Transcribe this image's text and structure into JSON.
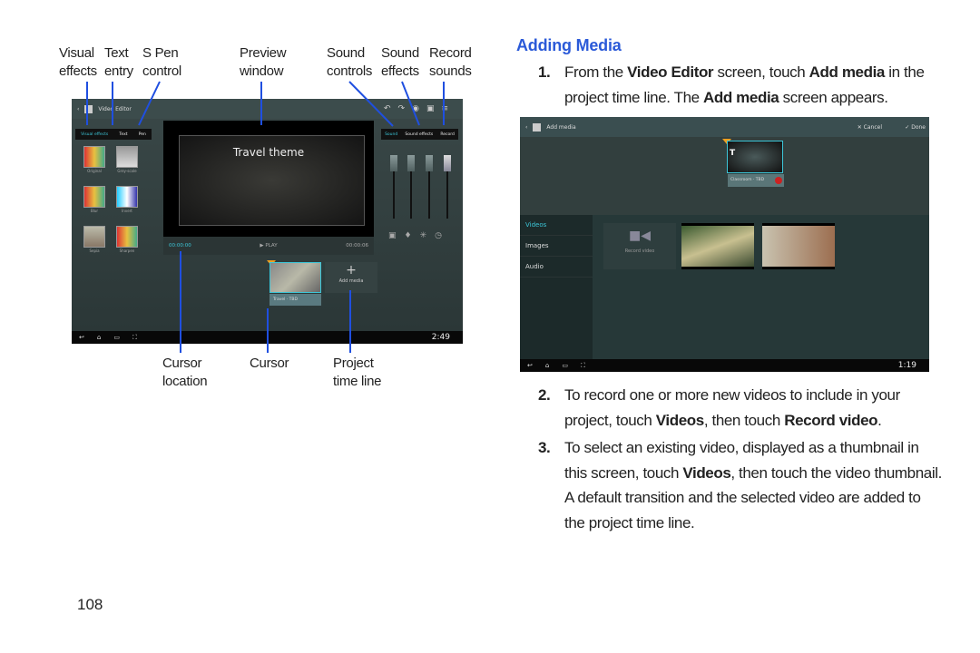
{
  "callouts_top": [
    {
      "line1": "Visual",
      "line2": "effects"
    },
    {
      "line1": "Text",
      "line2": "entry"
    },
    {
      "line1": "S Pen",
      "line2": "control"
    },
    {
      "line1": "Preview",
      "line2": "window"
    },
    {
      "line1": "Sound",
      "line2": "controls"
    },
    {
      "line1": "Sound",
      "line2": "effects"
    },
    {
      "line1": "Record",
      "line2": "sounds"
    }
  ],
  "callouts_bottom": [
    {
      "line1": "Cursor",
      "line2": "location"
    },
    {
      "line1": "Cursor",
      "line2": ""
    },
    {
      "line1": "Project",
      "line2": "time line"
    }
  ],
  "video_editor": {
    "title": "Video Editor",
    "left_tabs": [
      "Visual effects",
      "Text",
      "Pen"
    ],
    "effects": [
      "Original",
      "Grey-scale",
      "Blur",
      "Invert",
      "Sepia",
      "Sharpen"
    ],
    "preview_title": "Travel theme",
    "time_current": "00:00:00",
    "play_label": "PLAY",
    "time_total": "00:00:06",
    "right_tabs": [
      "Sound",
      "Sound effects",
      "Record"
    ],
    "clip_label": "Travel · TBD",
    "add_media": "Add media",
    "clock": "2:49"
  },
  "add_media_screen": {
    "title": "Add media",
    "cancel": "Cancel",
    "done": "Done",
    "clip_label": "Classroom · TBD",
    "sidebar": [
      "Videos",
      "Images",
      "Audio"
    ],
    "record_video": "Record video",
    "clock": "1:19"
  },
  "heading": "Adding Media",
  "steps": [
    {
      "num": "1.",
      "parts": [
        [
          "From the ",
          ""
        ],
        [
          "Video Editor",
          "b"
        ],
        [
          " screen, touch ",
          ""
        ],
        [
          "Add media",
          "b"
        ],
        [
          " in the project time line. The ",
          ""
        ],
        [
          "Add media",
          "b"
        ],
        [
          " screen appears.",
          ""
        ]
      ]
    },
    {
      "num": "2.",
      "parts": [
        [
          "To record one or more new videos to include in your project, touch ",
          ""
        ],
        [
          "Videos",
          "b"
        ],
        [
          ", then touch ",
          ""
        ],
        [
          "Record video",
          "b"
        ],
        [
          ".",
          ""
        ]
      ]
    },
    {
      "num": "3.",
      "parts": [
        [
          "To select an existing video, displayed as a thumbnail in this screen, touch ",
          ""
        ],
        [
          "Videos",
          "b"
        ],
        [
          ", then touch the video thumbnail. A default transition and the selected video are added to the project time line.",
          ""
        ]
      ]
    }
  ],
  "page_number": "108",
  "colors": {
    "heading": "#2b5ad8",
    "callout_line": "#1f4fe0",
    "accent": "#3cc6d8"
  }
}
